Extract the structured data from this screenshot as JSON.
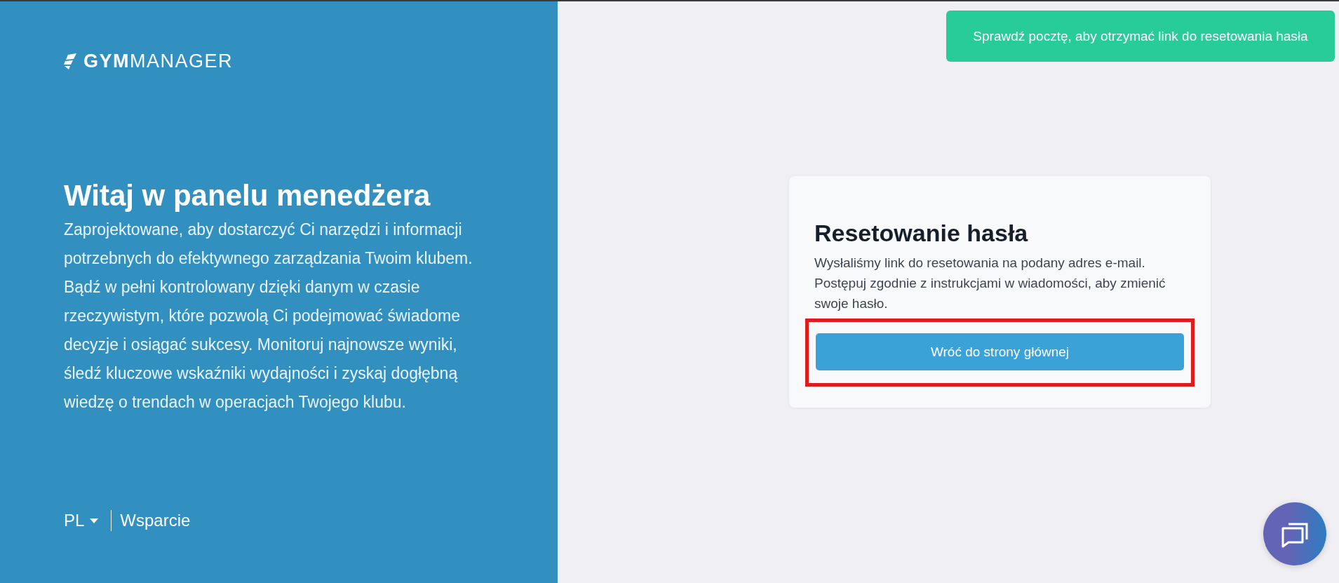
{
  "brand": {
    "logo": "**GYM**MANAGER"
  },
  "welcome": {
    "title": "Witaj w panelu menedżera",
    "text": "Zaprojektowane, aby dostarczyć Ci narzędzi i informacji potrzebnych do efektywnego zarządzania Twoim klubem. Bądź w pełni kontrolowany dzięki danym w czasie rzeczywistym, które pozwolą Ci podejmować świadome decyzje i osiągać sukcesy. Monitoruj najnowsze wyniki, śledź kluczowe wskaźniki wydajności i zyskaj dogłębną wiedzę o trendach w operacjach Twojego klubu."
  },
  "footer": {
    "language": "PL",
    "support": "Wsparcie"
  },
  "toast": {
    "message": "Sprawdź pocztę, aby otrzymać link do resetowania hasła"
  },
  "card": {
    "title": "Resetowanie hasła",
    "text": "Wysłaliśmy link do resetowania na podany adres e-mail. Postępuj zgodnie z instrukcjami w wiadomości, aby zmienić swoje hasło.",
    "button": {
      "label": "Wróć do strony głównej",
      "highlighted": true
    }
  }
}
